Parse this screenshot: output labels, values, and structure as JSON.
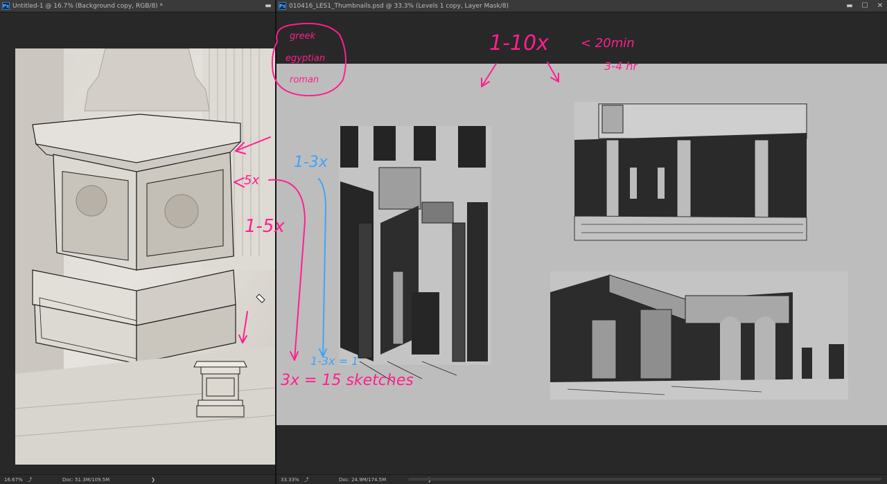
{
  "left_window": {
    "title": "Untitled-1 @ 16.7% (Background copy, RGB/8) *",
    "minimize": "▬",
    "zoom": "16.67%",
    "doc": "Doc: 51.3M/109.5M",
    "arrow": "❯"
  },
  "right_window": {
    "title": "010416_LES1_Thumbnails.psd @ 33.3% (Levels 1 copy, Layer Mask/8)",
    "minimize": "▬",
    "maximize": "☐",
    "close": "✕",
    "zoom": "33.33%",
    "doc": "Doc: 24.9M/174.5M",
    "arrow": "❯"
  },
  "annotations": {
    "circle_lines": [
      "greek",
      "egyptian",
      "roman"
    ],
    "five_x": "5x",
    "one_five_x": "1-5x",
    "one_three_x": "1-3x",
    "one_three_x_eq": "1-3x = 1",
    "three_x_eq": "3x = 15 sketches",
    "one_ten_x": "1-10x",
    "lt_20min": "< 20min",
    "three_four_hr": "3-4 hr"
  },
  "colors": {
    "pink": "#ff1f8f",
    "blue": "#3aa4ff",
    "ink": "#222222"
  }
}
